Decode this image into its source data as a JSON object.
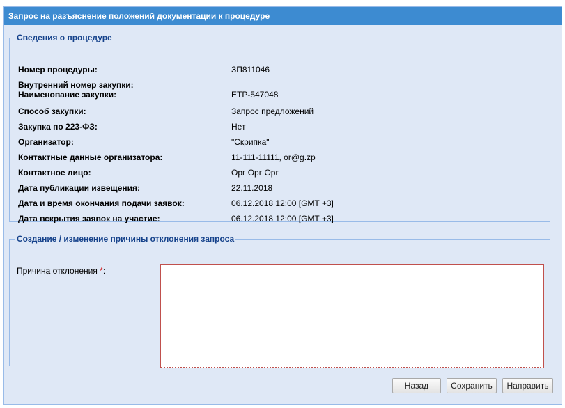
{
  "window": {
    "title": "Запрос на разъяснение положений документации к процедуре"
  },
  "procedure_info": {
    "legend": "Сведения о процедуре",
    "rows": [
      {
        "label": "Номер процедуры:",
        "value": "ЗП811046"
      },
      {
        "label": "Внутренний номер закупки:",
        "value": ""
      },
      {
        "label": "Наименование закупки:",
        "value": "ЕТР-547048"
      },
      {
        "label": "Способ закупки:",
        "value": "Запрос предложений"
      },
      {
        "label": "Закупка по 223-ФЗ:",
        "value": "Нет"
      },
      {
        "label": "Организатор:",
        "value": "\"Скрипка\""
      },
      {
        "label": "Контактные данные организатора:",
        "value": "11-111-11111, or@g.zp"
      },
      {
        "label": "Контактное лицо:",
        "value": "Орг Орг Орг"
      },
      {
        "label": "Дата публикации извещения:",
        "value": "22.11.2018"
      },
      {
        "label": "Дата и время окончания подачи заявок:",
        "value": "06.12.2018 12:00 [GMT +3]"
      },
      {
        "label": "Дата вскрытия заявок на участие:",
        "value": "06.12.2018 12:00 [GMT +3]"
      }
    ]
  },
  "rejection": {
    "legend": "Создание / изменение причины отклонения запроса",
    "reason_label": "Причина отклонения",
    "required_mark": "*",
    "label_suffix": ":",
    "reason_value": ""
  },
  "buttons": {
    "back": "Назад",
    "save": "Сохранить",
    "send": "Направить"
  },
  "colors": {
    "titlebar": "#3d8bd1",
    "panel_bg": "#dfe8f6",
    "legend_text": "#15428b",
    "required": "#d40000"
  }
}
